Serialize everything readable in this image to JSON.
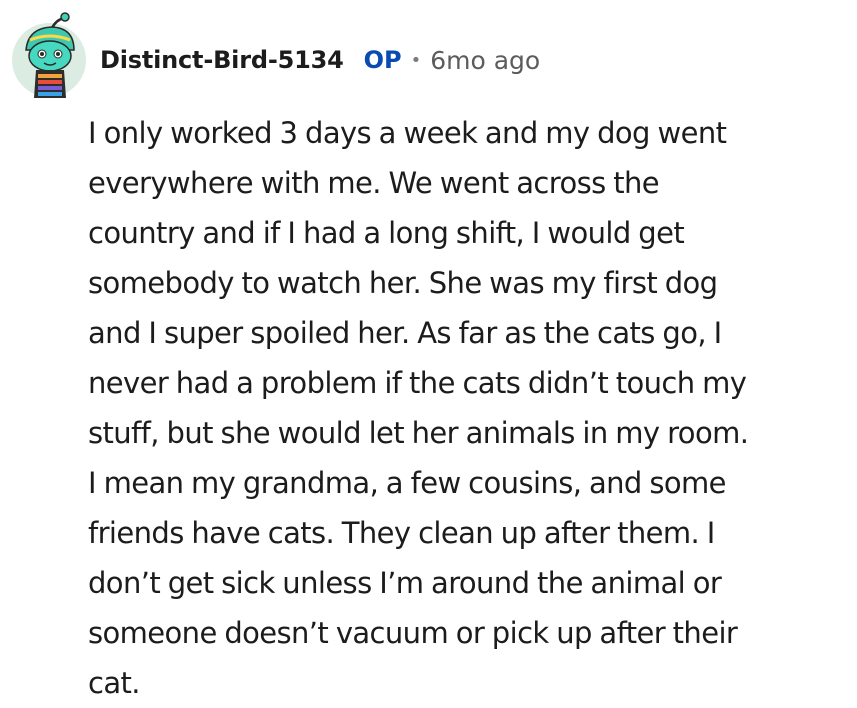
{
  "comment": {
    "author": "Distinct-Bird-5134",
    "op_badge": "OP",
    "separator": "•",
    "timestamp": "6mo ago",
    "body_lines": [
      "I only worked 3 days a week and my dog went",
      "everywhere with me. We went across the",
      "country and if I had a long shift, I would get",
      "somebody to watch her. She was my first dog",
      "and I super spoiled her. As far as the cats go, I",
      "never had a problem if the cats didn’t touch my",
      "stuff, but she would let her animals in my room.",
      "I mean my grandma, a few cousins, and some",
      "friends have cats. They clean up after them. I",
      "don’t get sick unless I’m around the animal or",
      "someone doesn’t vacuum or pick up after their",
      "cat."
    ],
    "avatar_icon": "snoo-avatar-icon"
  },
  "colors": {
    "username": "#1c1c1c",
    "op_badge": "#0a4bb1",
    "timestamp": "#5c5c5c",
    "body": "#1c1c1c",
    "avatar_bg": "#d8ebe0",
    "avatar_face": "#36c7ad"
  }
}
